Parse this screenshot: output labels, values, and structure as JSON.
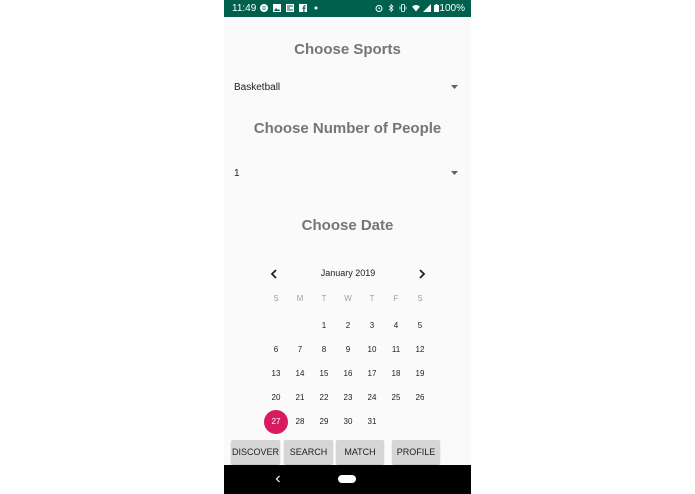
{
  "status_bar": {
    "time": "11:49",
    "battery": "100%",
    "background": "#00604e",
    "icons": [
      "spotify-icon",
      "image-icon",
      "news-icon",
      "facebook-icon",
      "dot-icon",
      "alarm-icon",
      "bluetooth-icon",
      "vibrate-icon",
      "wifi-icon",
      "signal-icon",
      "battery-icon"
    ]
  },
  "sports": {
    "heading": "Choose Sports",
    "selected": "Basketball"
  },
  "people": {
    "heading": "Choose Number of People",
    "selected": "1"
  },
  "date": {
    "heading": "Choose Date",
    "month_label": "January 2019",
    "weekdays": [
      "S",
      "M",
      "T",
      "W",
      "T",
      "F",
      "S"
    ],
    "weeks": [
      [
        "",
        "",
        "1",
        "2",
        "3",
        "4",
        "5"
      ],
      [
        "6",
        "7",
        "8",
        "9",
        "10",
        "11",
        "12"
      ],
      [
        "13",
        "14",
        "15",
        "16",
        "17",
        "18",
        "19"
      ],
      [
        "20",
        "21",
        "22",
        "23",
        "24",
        "25",
        "26"
      ],
      [
        "27",
        "28",
        "29",
        "30",
        "31",
        "",
        ""
      ]
    ],
    "selected_day": "27",
    "accent_color": "#d81b60"
  },
  "nav_buttons": {
    "discover": "DISCOVER",
    "search": "SEARCH",
    "match": "MATCH",
    "profile": "PROFILE"
  },
  "heading_color": "#757575"
}
